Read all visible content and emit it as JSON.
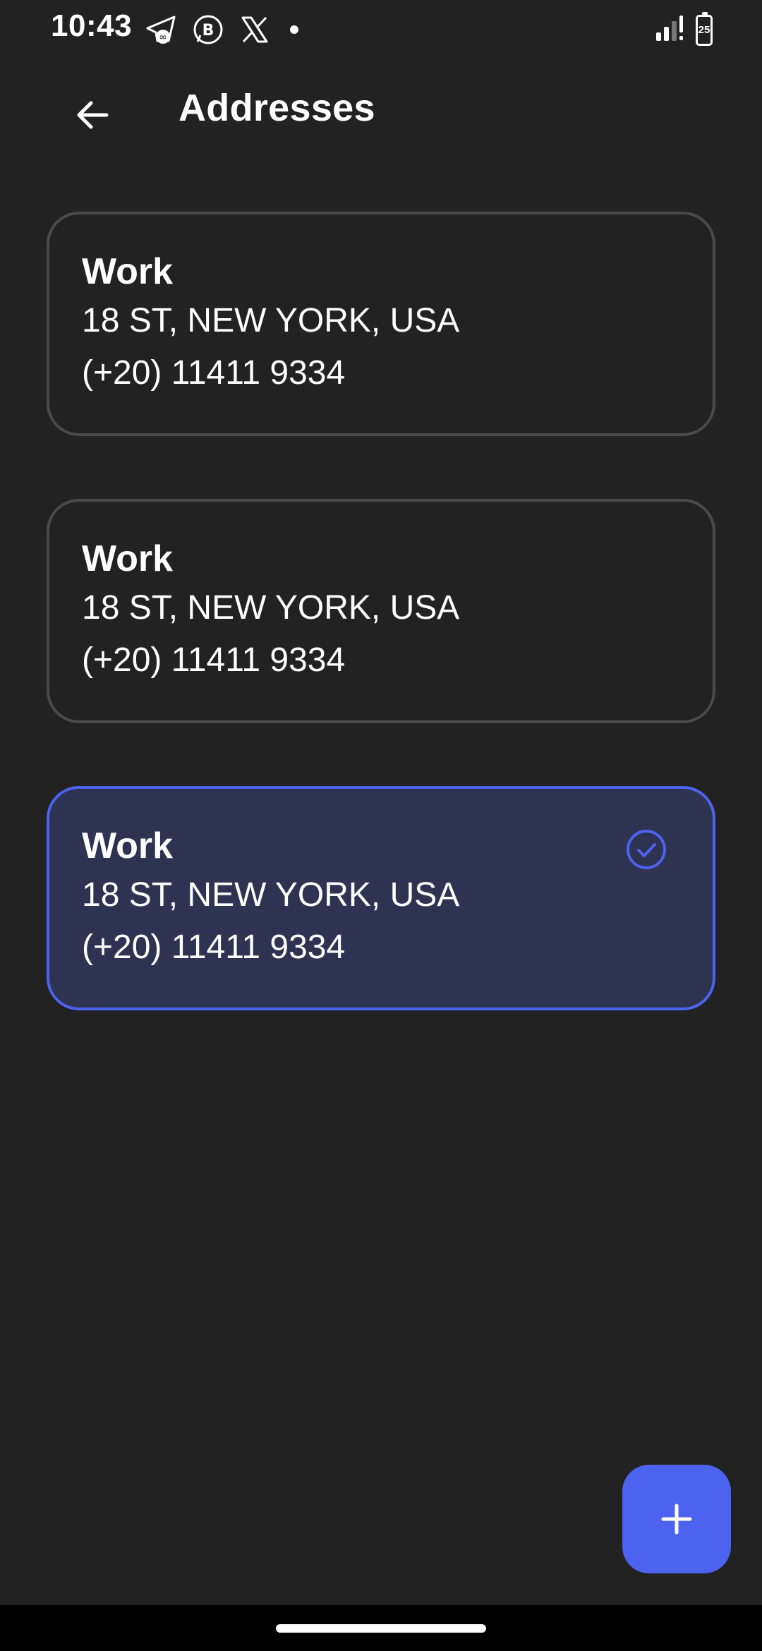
{
  "status_bar": {
    "time": "10:43",
    "battery_level": "25",
    "notification_icons": [
      "telegram-icon",
      "whatsapp-business-icon",
      "x-icon",
      "dot-icon"
    ],
    "right_icons": [
      "signal-icon",
      "battery-icon"
    ]
  },
  "header": {
    "title": "Addresses",
    "back_icon": "arrow-left-icon"
  },
  "addresses": [
    {
      "label": "Work",
      "street": "18 ST, NEW YORK, USA",
      "phone": "(+20) 11411 9334",
      "selected": false
    },
    {
      "label": "Work",
      "street": "18 ST, NEW YORK, USA",
      "phone": "(+20) 11411 9334",
      "selected": false
    },
    {
      "label": "Work",
      "street": "18 ST, NEW YORK, USA",
      "phone": "(+20) 11411 9334",
      "selected": true
    }
  ],
  "fab": {
    "icon": "plus-icon"
  },
  "colors": {
    "background": "#222222",
    "accent": "#4b63ee",
    "selected_card": "#2f3352",
    "card_border": "#4a4a4a"
  }
}
